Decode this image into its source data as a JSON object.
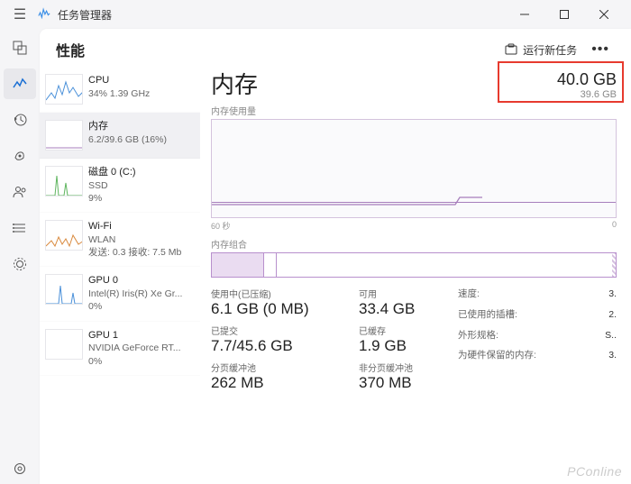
{
  "app": {
    "title": "任务管理器"
  },
  "window": {
    "minimize": "min",
    "maximize": "max",
    "close": "close"
  },
  "header": {
    "tab": "性能",
    "run_task": "运行新任务"
  },
  "list": [
    {
      "name": "CPU",
      "sub": "34%  1.39 GHz"
    },
    {
      "name": "内存",
      "sub": "6.2/39.6 GB (16%)"
    },
    {
      "name": "磁盘 0 (C:)",
      "sub1": "SSD",
      "sub2": "9%"
    },
    {
      "name": "Wi-Fi",
      "sub1": "WLAN",
      "sub2": "发送: 0.3 接收: 7.5 Mb"
    },
    {
      "name": "GPU 0",
      "sub1": "Intel(R) Iris(R) Xe Gr...",
      "sub2": "0%"
    },
    {
      "name": "GPU 1",
      "sub1": "NVIDIA GeForce RT...",
      "sub2": "0%"
    }
  ],
  "detail": {
    "title": "内存",
    "total": "40.0 GB",
    "avail": "39.6 GB",
    "usage_label": "内存使用量",
    "axis_left": "60 秒",
    "axis_right": "0",
    "comp_label": "内存组合",
    "stats": {
      "in_use_label": "使用中(已压缩)",
      "in_use": "6.1 GB (0 MB)",
      "available_label": "可用",
      "available": "33.4 GB",
      "committed_label": "已提交",
      "committed": "7.7/45.6 GB",
      "cached_label": "已缓存",
      "cached": "1.9 GB",
      "paged_label": "分页缓冲池",
      "paged": "262 MB",
      "nonpaged_label": "非分页缓冲池",
      "nonpaged": "370 MB"
    },
    "meta": {
      "speed_l": "速度:",
      "speed_v": "3.",
      "slots_l": "已使用的插槽:",
      "slots_v": "2.",
      "form_l": "外形规格:",
      "form_v": "S..",
      "hw_l": "为硬件保留的内存:",
      "hw_v": "3."
    }
  },
  "watermark": "PConline",
  "chart_data": {
    "type": "line",
    "title": "内存使用量",
    "xlabel": "秒",
    "x_range": [
      60,
      0
    ],
    "ylabel": "GB",
    "ylim": [
      0,
      39.6
    ],
    "series": [
      {
        "name": "使用中",
        "values_approx_gb": [
          6.0,
          6.0,
          6.0,
          6.0,
          6.0,
          6.0,
          6.2,
          6.2,
          6.2,
          6.2,
          6.2
        ]
      }
    ]
  }
}
